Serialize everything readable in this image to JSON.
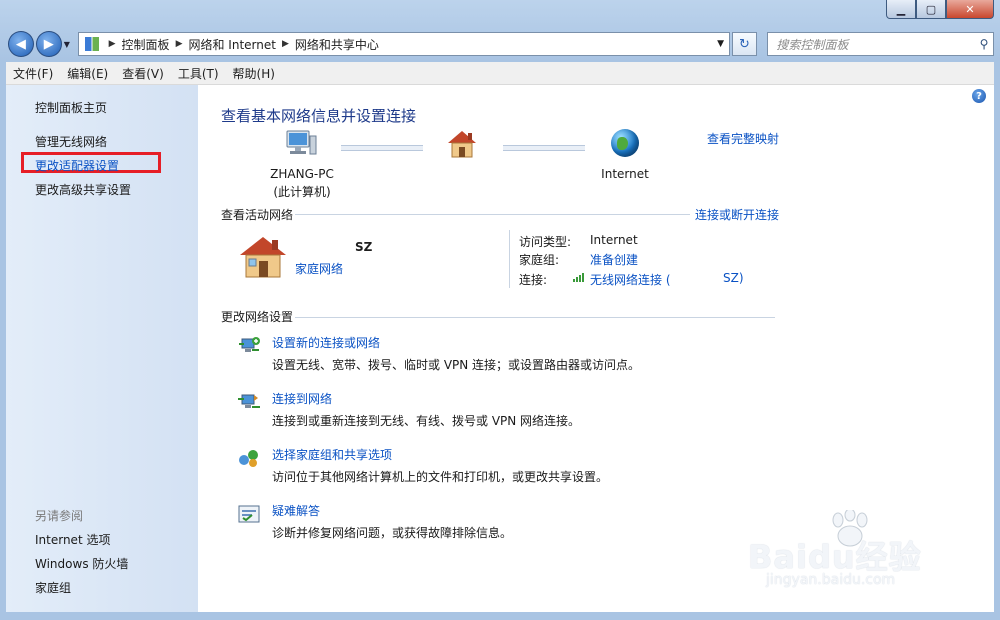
{
  "window": {
    "caption_buttons": [
      "minimize",
      "maximize",
      "close"
    ]
  },
  "address": {
    "crumbs": [
      "控制面板",
      "网络和 Internet",
      "网络和共享中心"
    ],
    "search_placeholder": "搜索控制面板"
  },
  "menu": [
    "文件(F)",
    "编辑(E)",
    "查看(V)",
    "工具(T)",
    "帮助(H)"
  ],
  "sidebar": {
    "home": "控制面板主页",
    "items": [
      "管理无线网络",
      "更改适配器设置",
      "更改高级共享设置"
    ],
    "see_also_title": "另请参阅",
    "see_also": [
      "Internet 选项",
      "Windows 防火墙",
      "家庭组"
    ]
  },
  "main": {
    "title": "查看基本网络信息并设置连接",
    "view_map_link": "查看完整映射",
    "map": {
      "computer_name": "ZHANG-PC",
      "computer_sub": "(此计算机)",
      "internet": "Internet"
    },
    "active_section": "查看活动网络",
    "connect_link": "连接或断开连接",
    "network": {
      "name": "SZ",
      "type_link": "家庭网络",
      "access_type_label": "访问类型:",
      "access_type_value": "Internet",
      "homegroup_label": "家庭组:",
      "homegroup_value": "准备创建",
      "connection_label": "连接:",
      "connection_value": "无线网络连接 (",
      "connection_tail": "SZ)"
    },
    "change_section": "更改网络设置",
    "tasks": [
      {
        "link": "设置新的连接或网络",
        "desc": "设置无线、宽带、拨号、临时或 VPN 连接；或设置路由器或访问点。"
      },
      {
        "link": "连接到网络",
        "desc": "连接到或重新连接到无线、有线、拨号或 VPN 网络连接。"
      },
      {
        "link": "选择家庭组和共享选项",
        "desc": "访问位于其他网络计算机上的文件和打印机，或更改共享设置。"
      },
      {
        "link": "疑难解答",
        "desc": "诊断并修复网络问题，或获得故障排除信息。"
      }
    ]
  },
  "watermark": {
    "logo_text": "Baidu经验",
    "url": "jingyan.baidu.com"
  },
  "colors": {
    "link": "#0a52c4",
    "title": "#1e3a8a",
    "highlight_box": "#e61e26"
  }
}
